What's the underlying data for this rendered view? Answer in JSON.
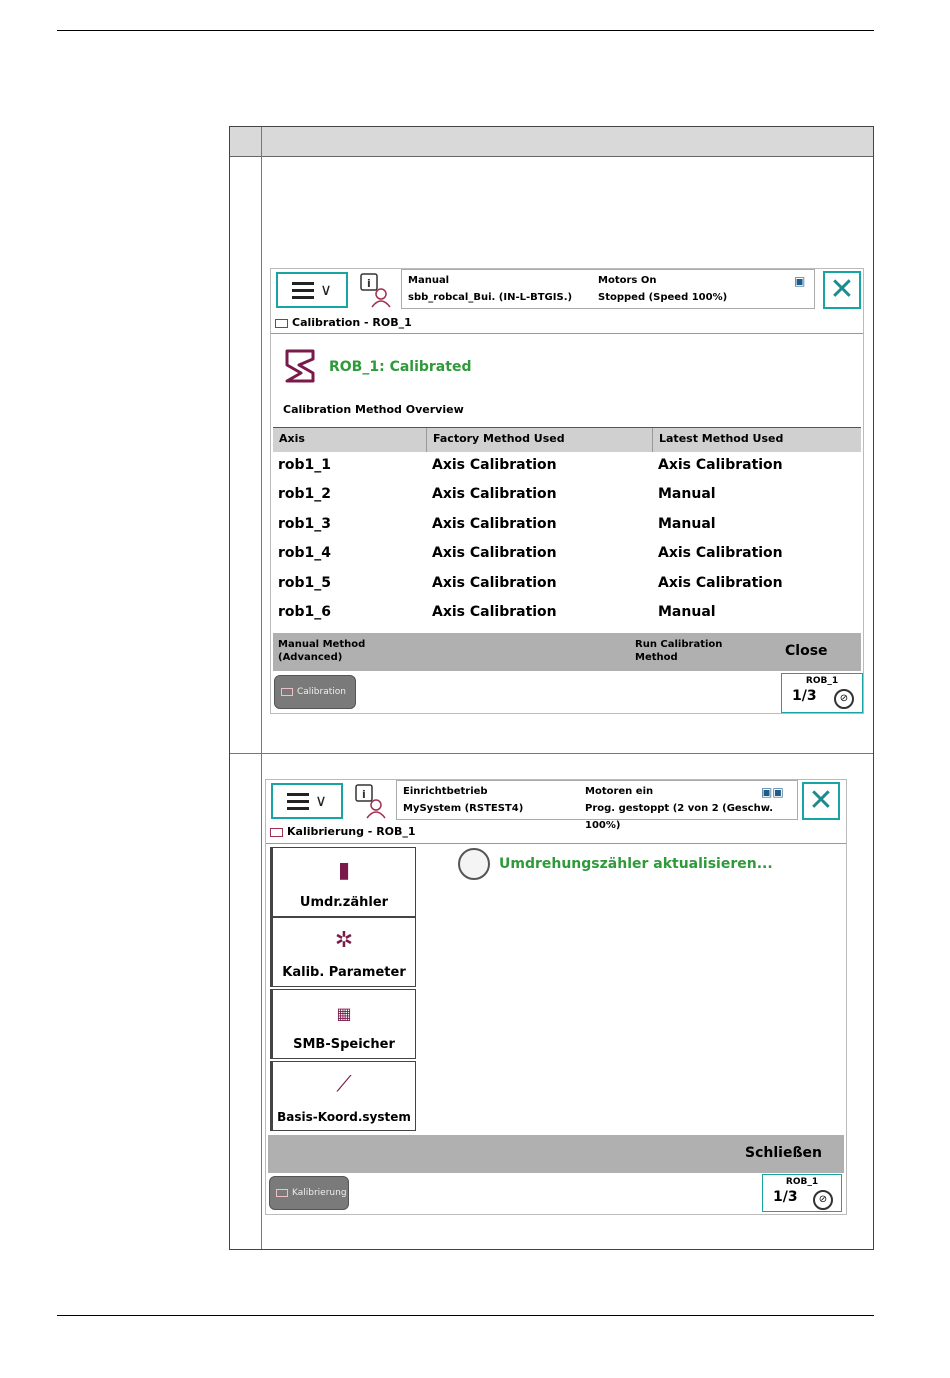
{
  "screen1": {
    "status": {
      "mode": "Manual",
      "system": "sbb_robcal_Bui. (IN-L-BTGIS.)",
      "motors": "Motors On",
      "state": "Stopped (Speed 100%)"
    },
    "title": "Calibration - ROB_1",
    "robot_status": "ROB_1:  Calibrated",
    "overview_title": "Calibration Method Overview",
    "columns": [
      "Axis",
      "Factory Method Used",
      "Latest Method Used"
    ],
    "rows": [
      {
        "axis": "rob1_1",
        "factory": "Axis Calibration",
        "latest": "Axis Calibration"
      },
      {
        "axis": "rob1_2",
        "factory": "Axis Calibration",
        "latest": "Manual"
      },
      {
        "axis": "rob1_3",
        "factory": "Axis Calibration",
        "latest": "Manual"
      },
      {
        "axis": "rob1_4",
        "factory": "Axis Calibration",
        "latest": "Axis Calibration"
      },
      {
        "axis": "rob1_5",
        "factory": "Axis Calibration",
        "latest": "Axis Calibration"
      },
      {
        "axis": "rob1_6",
        "factory": "Axis Calibration",
        "latest": "Manual"
      }
    ],
    "commands": {
      "manual": "Manual Method (Advanced)",
      "run": "Run Calibration Method",
      "close": "Close"
    },
    "taskbar": {
      "app": "Calibration",
      "robot": "ROB_1",
      "fraction": "1/3"
    }
  },
  "screen2": {
    "status": {
      "mode": "Einrichtbetrieb",
      "system": "MySystem (RSTEST4)",
      "motors": "Motoren ein",
      "state": "Prog. gestoppt (2 von 2 (Geschw. 100%)"
    },
    "title": "Kalibrierung - ROB_1",
    "side_buttons": [
      "Umdr.zähler",
      "Kalib. Parameter",
      "SMB-Speicher",
      "Basis-Koord.system"
    ],
    "message": "Umdrehungszähler aktualisieren...",
    "commands": {
      "close": "Schließen"
    },
    "taskbar": {
      "app": "Kalibrierung",
      "robot": "ROB_1",
      "fraction": "1/3"
    }
  },
  "icons": [
    "menu-icon",
    "user-info-icon",
    "close-icon",
    "robot-calibration-icon",
    "revolution-counter-icon",
    "calib-parameters-icon",
    "smb-memory-icon",
    "base-frame-icon"
  ]
}
